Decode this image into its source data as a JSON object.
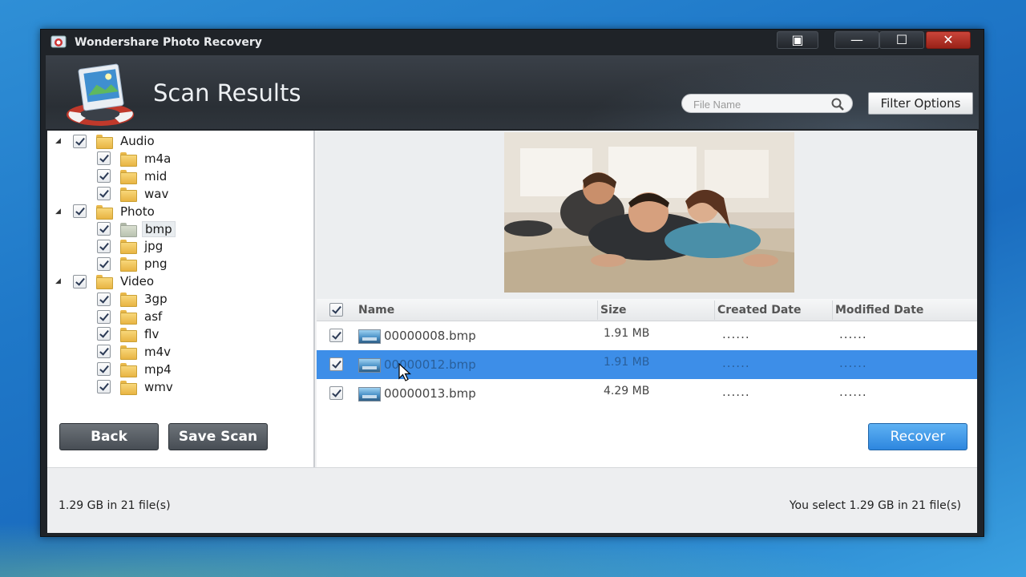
{
  "window": {
    "title": "Wondershare Photo Recovery",
    "controls": [
      "restore",
      "minimize",
      "maximize",
      "close"
    ]
  },
  "header": {
    "title": "Scan Results",
    "search_placeholder": "File Name",
    "filter_label": "Filter Options"
  },
  "tree": {
    "items": [
      {
        "label": "Audio",
        "level": 0,
        "expanded": true,
        "checked": true
      },
      {
        "label": "m4a",
        "level": 1,
        "checked": true
      },
      {
        "label": "mid",
        "level": 1,
        "checked": true
      },
      {
        "label": "wav",
        "level": 1,
        "checked": true
      },
      {
        "label": "Photo",
        "level": 0,
        "expanded": true,
        "checked": true
      },
      {
        "label": "bmp",
        "level": 1,
        "checked": true,
        "selected": true
      },
      {
        "label": "jpg",
        "level": 1,
        "checked": true
      },
      {
        "label": "png",
        "level": 1,
        "checked": true
      },
      {
        "label": "Video",
        "level": 0,
        "expanded": true,
        "checked": true
      },
      {
        "label": "3gp",
        "level": 1,
        "checked": true
      },
      {
        "label": "asf",
        "level": 1,
        "checked": true
      },
      {
        "label": "flv",
        "level": 1,
        "checked": true
      },
      {
        "label": "m4v",
        "level": 1,
        "checked": true
      },
      {
        "label": "mp4",
        "level": 1,
        "checked": true
      },
      {
        "label": "wmv",
        "level": 1,
        "checked": true
      }
    ]
  },
  "list": {
    "columns": {
      "name": "Name",
      "size": "Size",
      "created": "Created Date",
      "modified": "Modified Date"
    },
    "rows": [
      {
        "name": "00000008.bmp",
        "size": "1.91 MB",
        "created": "......",
        "modified": "......",
        "checked": true
      },
      {
        "name": "00000012.bmp",
        "size": "1.91 MB",
        "created": "......",
        "modified": "......",
        "checked": true,
        "selected": true
      },
      {
        "name": "00000013.bmp",
        "size": "4.29 MB",
        "created": "......",
        "modified": "......",
        "checked": true
      }
    ]
  },
  "status": {
    "left": "1.29 GB in 21 file(s)",
    "right": "You select 1.29 GB in 21 file(s)"
  },
  "buttons": {
    "back": "Back",
    "save_scan": "Save Scan",
    "recover": "Recover"
  },
  "colors": {
    "selection": "#3d8ee8",
    "recover_button": "#2d86de",
    "title_bar": "#1f2328"
  }
}
